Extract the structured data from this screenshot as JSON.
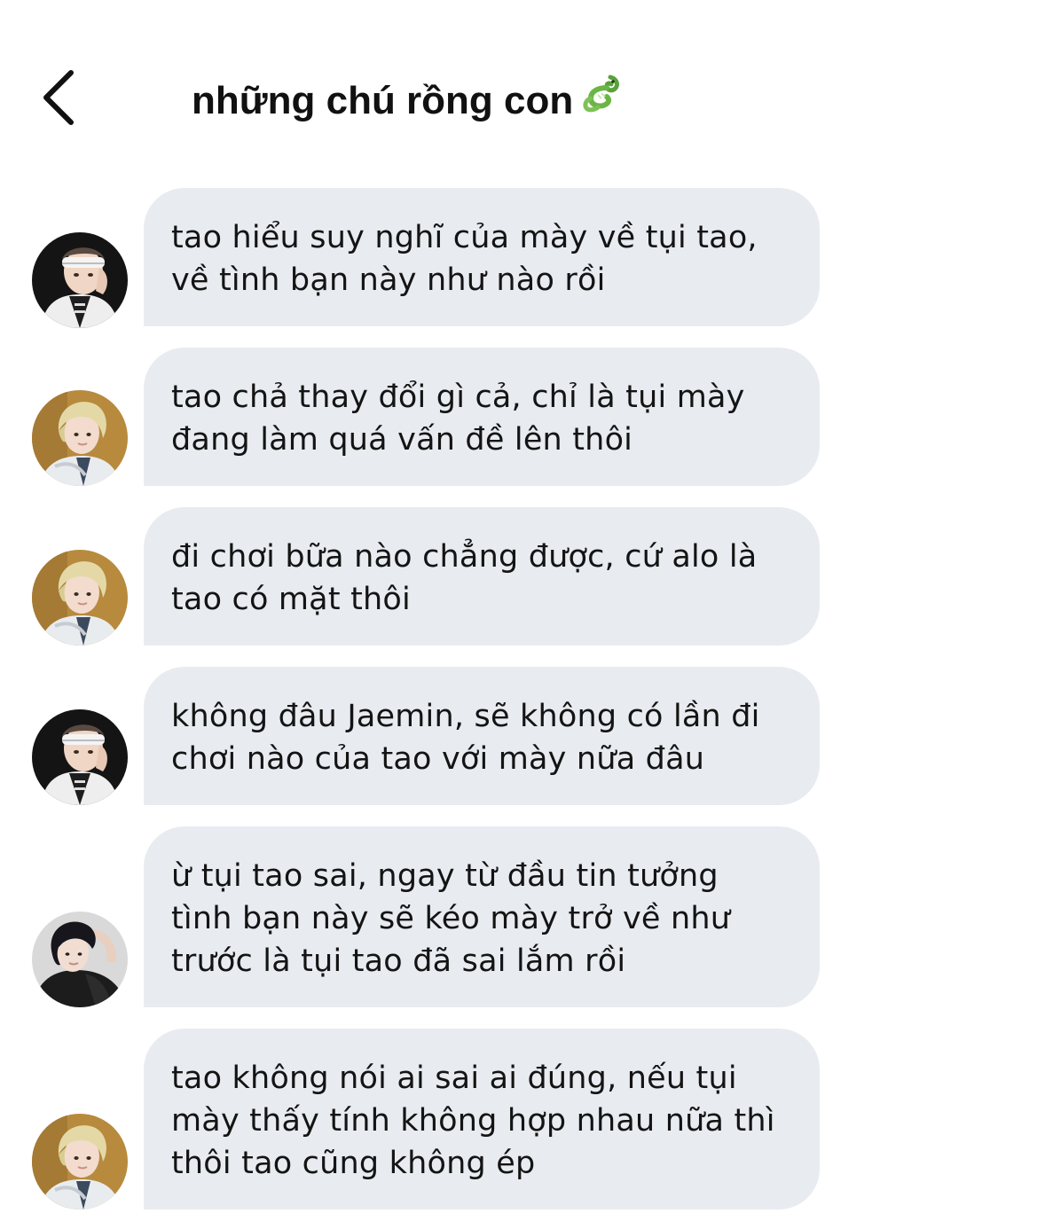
{
  "header": {
    "title": "những chú rồng con",
    "title_icon": "dragon-emoji",
    "back_icon": "chevron-left-icon"
  },
  "messages": [
    {
      "avatar": "avatar-headband",
      "text": "tao hiểu suy nghĩ của mày về tụi tao,\nvề tình bạn này như nào rồi"
    },
    {
      "avatar": "avatar-blonde",
      "text": "tao chả thay đổi gì cả, chỉ là tụi mày\nđang làm quá vấn đề lên thôi"
    },
    {
      "avatar": "avatar-blonde",
      "text": "đi chơi bữa nào chẳng được, cứ alo là\ntao có mặt thôi"
    },
    {
      "avatar": "avatar-headband",
      "text": "không đâu Jaemin, sẽ không có lần đi\nchơi nào của tao với mày nữa đâu"
    },
    {
      "avatar": "avatar-dark-hair",
      "text": "ừ tụi tao sai, ngay từ đầu tin tưởng\ntình bạn này sẽ kéo mày trở về như\ntrước là tụi tao đã sai lắm rồi"
    },
    {
      "avatar": "avatar-blonde",
      "text": "tao không nói ai sai ai đúng, nếu tụi\nmày thấy tính không hợp nhau nữa thì\nthôi tao cũng không ép"
    }
  ],
  "colors": {
    "bubble": "#e8ebf0",
    "text": "#141414",
    "background": "#ffffff"
  }
}
